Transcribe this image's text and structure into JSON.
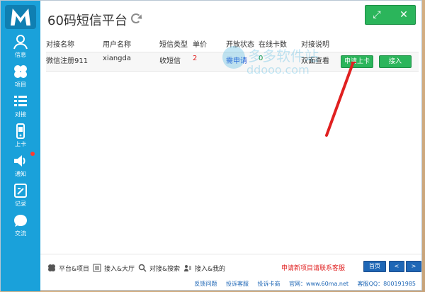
{
  "app": {
    "title": "60码短信平台"
  },
  "sidebar": {
    "items": [
      {
        "label": "信息",
        "icon": "person-icon"
      },
      {
        "label": "项目",
        "icon": "clover-icon"
      },
      {
        "label": "对接",
        "icon": "list-icon"
      },
      {
        "label": "上卡",
        "icon": "phone-icon"
      },
      {
        "label": "通知",
        "icon": "speaker-icon"
      },
      {
        "label": "记录",
        "icon": "notebook-icon"
      },
      {
        "label": "交流",
        "icon": "chat-icon"
      }
    ]
  },
  "table": {
    "headers": [
      "对接名称",
      "用户名称",
      "短信类型",
      "单价",
      "开放状态",
      "在线卡数",
      "对接说明"
    ],
    "rows": [
      {
        "name": "微信注册911",
        "user": "xiangda",
        "type": "收短信",
        "price": "2",
        "status": "需申请",
        "online_cards": "0",
        "desc": "双面查看"
      }
    ]
  },
  "actions": {
    "apply_card": "申请上卡",
    "connect": "接入"
  },
  "watermark": {
    "line1": "多多软件站",
    "line2": "ddooo.com"
  },
  "bottom": {
    "quick_links": [
      {
        "label": "平台&项目",
        "icon": "clover-icon"
      },
      {
        "label": "接入&大厅",
        "icon": "list-icon"
      },
      {
        "label": "对接&搜索",
        "icon": "search-icon"
      },
      {
        "label": "接入&我的",
        "icon": "user-list-icon"
      }
    ],
    "notice": "申请新项目请联系客服",
    "pager": {
      "first": "首页",
      "prev": "<",
      "next": ">"
    },
    "footer_links": [
      "反馈问题",
      "投诉客服",
      "投诉卡商",
      "官网：www.60ma.net",
      "客服QQ：800191985"
    ]
  },
  "colors": {
    "sidebar": "#1aa1da",
    "green": "#2bb55b",
    "red": "#e02020",
    "blue_link": "#1f67b6"
  }
}
